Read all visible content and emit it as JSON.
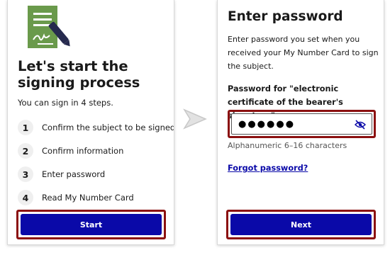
{
  "left_screen": {
    "title": "Let's start the signing process",
    "subtitle": "You can sign in 4 steps.",
    "steps": [
      {
        "num": "1",
        "label": "Confirm the subject to be signed"
      },
      {
        "num": "2",
        "label": "Confirm information"
      },
      {
        "num": "3",
        "label": "Enter password"
      },
      {
        "num": "4",
        "label": "Read My Number Card"
      }
    ],
    "start_label": "Start",
    "icon": "document-sign-icon"
  },
  "right_screen": {
    "title": "Enter password",
    "description": "Enter password you set when you received your My Number Card to sign the subject.",
    "field_label": "Password for \"electronic certificate of the bearer's signature\"",
    "password_masked": "●●●●●●",
    "hint": "Alphanumeric 6–16 characters",
    "forgot_label": "Forgot password?",
    "next_label": "Next"
  },
  "colors": {
    "primary_button": "#0a09a8",
    "highlight_frame": "#8b1010",
    "icon_green": "#6a9a4b"
  }
}
